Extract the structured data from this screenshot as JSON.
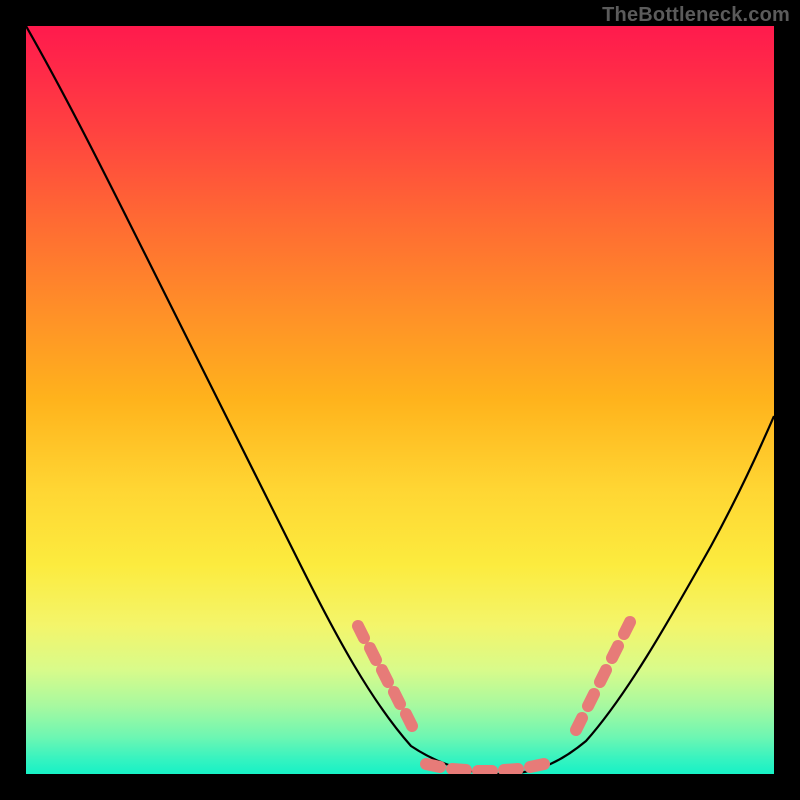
{
  "watermark": "TheBottleneck.com",
  "colors": {
    "frame": "#000000",
    "curve": "#000000",
    "marker": "#e77b78"
  },
  "chart_data": {
    "type": "line",
    "title": "",
    "xlabel": "",
    "ylabel": "",
    "xlim": [
      0,
      100
    ],
    "ylim": [
      0,
      100
    ],
    "grid": false,
    "legend": false,
    "series": [
      {
        "name": "bottleneck-curve",
        "x": [
          0,
          5,
          10,
          15,
          20,
          25,
          30,
          35,
          40,
          45,
          48,
          52,
          55,
          58,
          62,
          66,
          70,
          74,
          78,
          82,
          86,
          90,
          95,
          100
        ],
        "y": [
          100,
          96,
          90,
          82,
          73,
          63,
          53,
          43,
          33,
          22,
          13,
          7,
          3,
          1,
          0,
          0,
          1,
          4,
          9,
          16,
          24,
          33,
          43,
          55
        ]
      }
    ],
    "markers": {
      "name": "highlighted-points",
      "description": "salmon rounded segments along curve near the minimum",
      "left_cluster": {
        "x": [
          48,
          50,
          52,
          54,
          56
        ],
        "y": [
          21,
          18,
          15,
          12,
          9
        ]
      },
      "floor": {
        "x": [
          58,
          60,
          62,
          64,
          66,
          68,
          70
        ],
        "y": [
          2,
          1,
          0.5,
          0.3,
          0.5,
          1,
          2
        ]
      },
      "right_cluster": {
        "x": [
          72,
          74,
          76,
          78
        ],
        "y": [
          6,
          10,
          14,
          19
        ]
      }
    }
  }
}
